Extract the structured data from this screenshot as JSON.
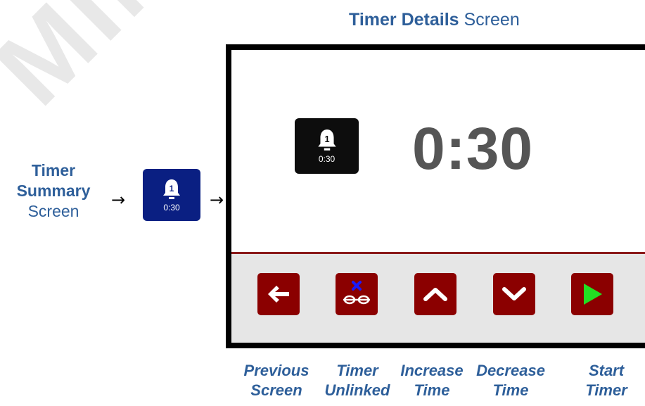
{
  "watermark": {
    "text": "MINIQUE"
  },
  "title": {
    "bold": "Timer Details",
    "plain": "Screen"
  },
  "summary_label": {
    "line1": "Timer",
    "line2": "Summary",
    "line3": "Screen"
  },
  "arrows": {
    "left": "→",
    "right": "→"
  },
  "timer_icon": {
    "number": "1",
    "time": "0:30"
  },
  "detail": {
    "time": "0:30"
  },
  "buttons": [
    {
      "icon": "arrow-left-icon",
      "label1": "Previous",
      "label2": "Screen"
    },
    {
      "icon": "unlinked-chain-icon",
      "label1": "Timer",
      "label2": "Unlinked"
    },
    {
      "icon": "chevron-up-icon",
      "label1": "Increase",
      "label2": "Time"
    },
    {
      "icon": "chevron-down-icon",
      "label1": "Decrease",
      "label2": "Time"
    },
    {
      "icon": "play-icon",
      "label1": "Start",
      "label2": "Timer"
    }
  ],
  "colors": {
    "accent_blue": "#2e5f9a",
    "summary_icon_bg": "#0a1f82",
    "button_red": "#8b0000",
    "play_green": "#22e022",
    "unlink_blue": "#1a1aff"
  }
}
